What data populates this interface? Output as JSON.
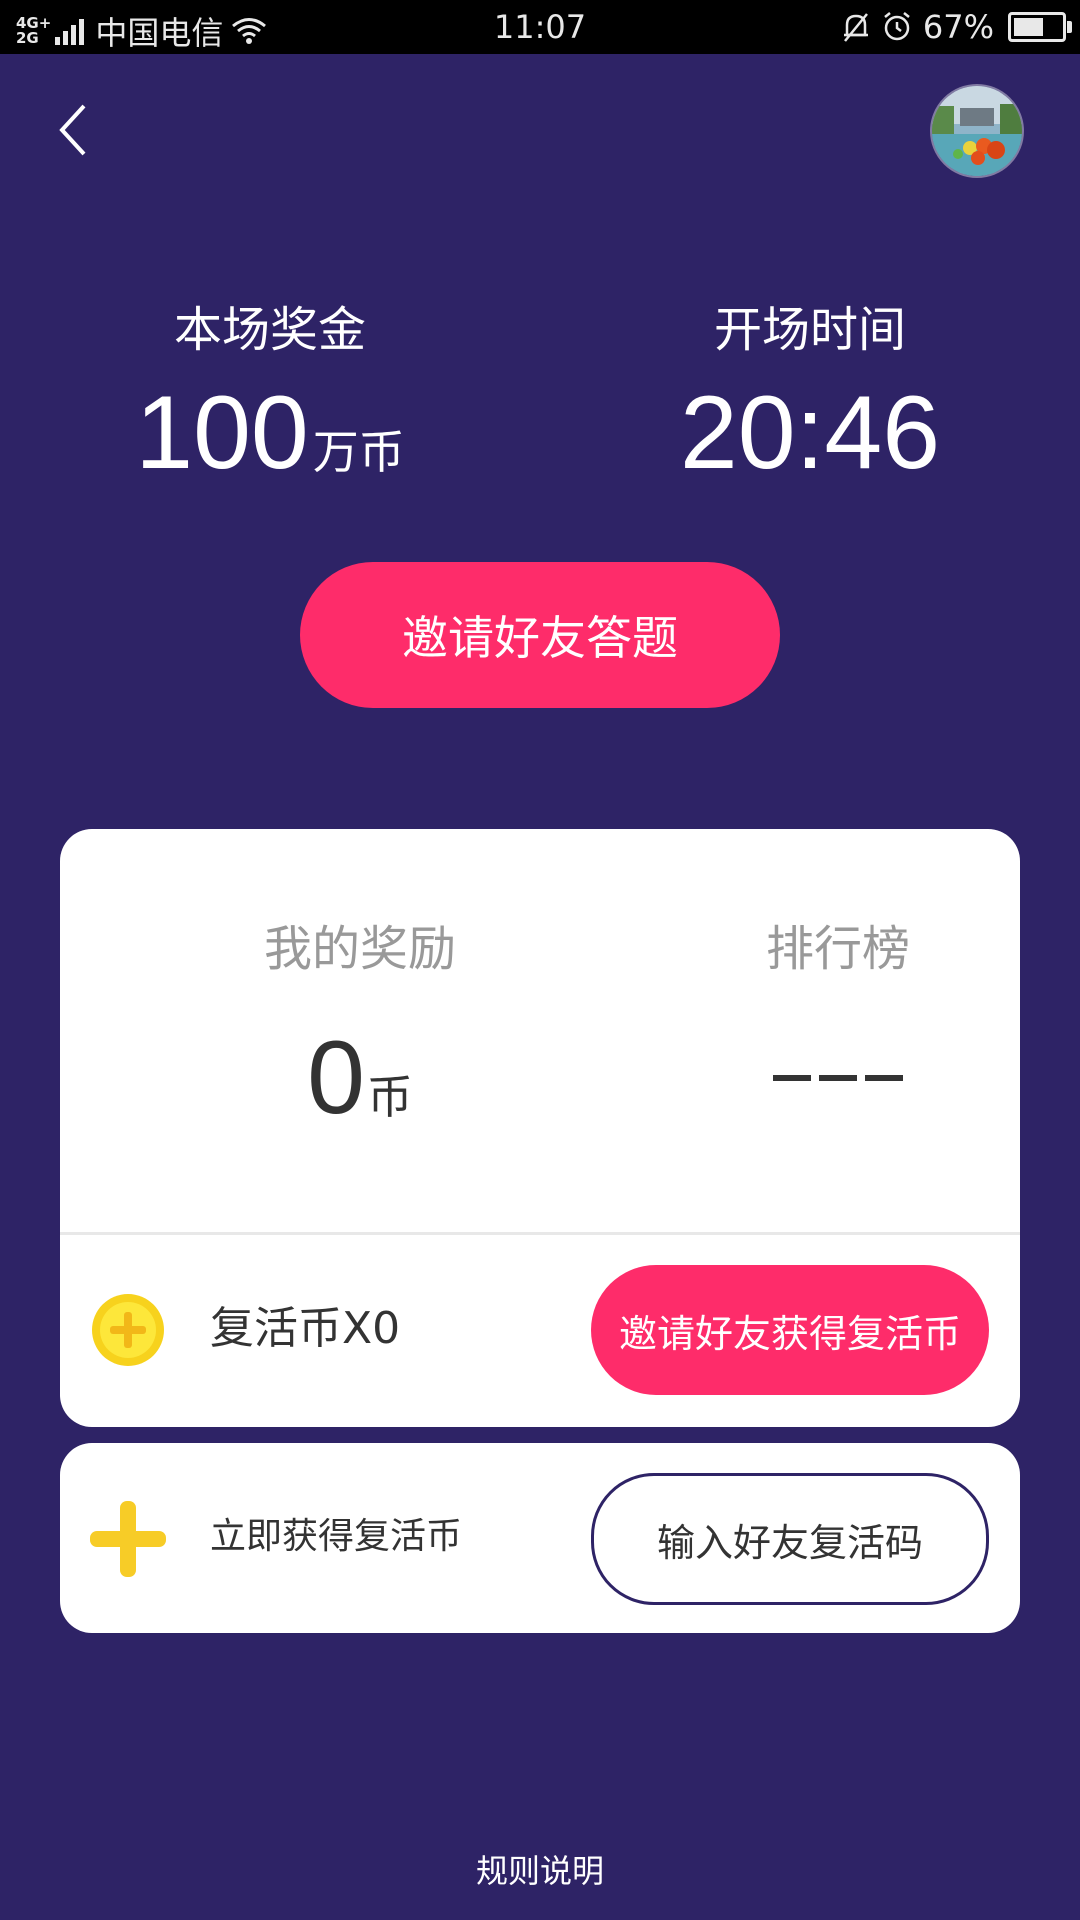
{
  "status_bar": {
    "network": "4G+ 2G",
    "carrier": "中国电信",
    "time": "11:07",
    "battery": "67%",
    "battery_level": 0.67
  },
  "header": {
    "back_icon": "chevron-left-icon",
    "avatar": "user-avatar"
  },
  "prize": {
    "label": "本场奖金",
    "value": "100",
    "unit": "万币"
  },
  "start_time": {
    "label": "开场时间",
    "value": "20:46"
  },
  "invite_button": "邀请好友答题",
  "my_reward": {
    "label": "我的奖励",
    "value": "0",
    "unit": "币"
  },
  "ranking": {
    "label": "排行榜",
    "value": "---"
  },
  "revive": {
    "count_text": "复活币X0",
    "invite_button": "邀请好友获得复活币",
    "get_text": "立即获得复活币",
    "enter_code_button": "输入好友复活码"
  },
  "rules_link": "规则说明",
  "colors": {
    "background": "#2e2366",
    "accent": "#fe2c6a",
    "coin": "#f7d21d"
  }
}
